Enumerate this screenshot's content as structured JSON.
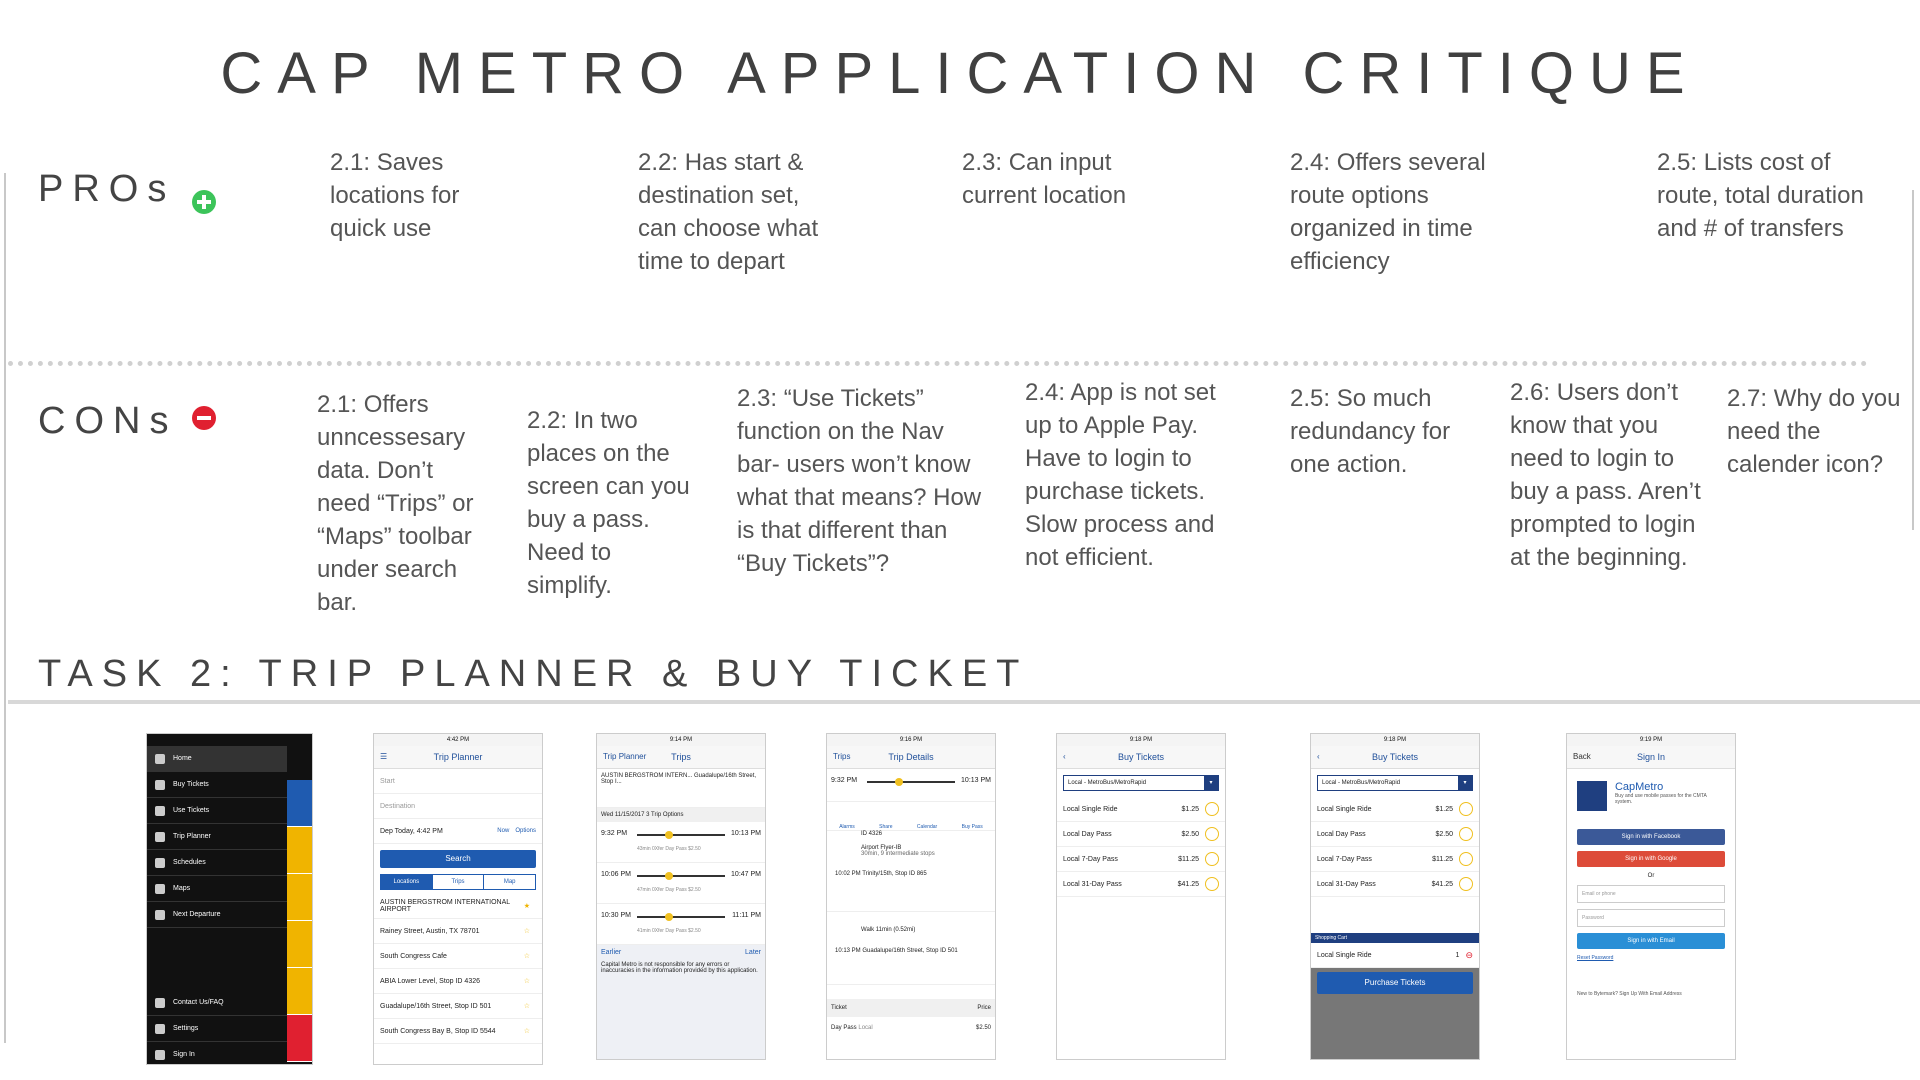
{
  "title": "CAP METRO APPLICATION CRITIQUE",
  "pros": {
    "label": "PROs",
    "items": [
      "2.1: Saves locations for quick use",
      "2.2: Has start & destination set, can choose what time to depart",
      "2.3: Can input current location",
      "2.4: Offers several route options organized in time efficiency",
      "2.5: Lists cost of route, total duration and # of transfers"
    ]
  },
  "cons": {
    "label": "CONs",
    "items": [
      "2.1: Offers unncessesary data. Don’t need “Trips” or “Maps” toolbar under search bar.",
      "2.2: In two places on the screen can you buy a pass. Need to simplify.",
      "2.3: “Use Tickets” function on the Nav bar- users won’t know what that means? How is that different than “Buy Tickets”?",
      "2.4: App is not set up to Apple Pay. Have to login to purchase tickets. Slow process and not efficient.",
      "2.5: So much redundancy for one action.",
      "2.6: Users don’t know that you need to login to buy a pass. Aren’t prompted to login at the beginning.",
      "2.7: Why do you need the calender icon?"
    ]
  },
  "task": "TASK 2: TRIP PLANNER & BUY TICKET",
  "screens": {
    "menu": {
      "items": [
        "Home",
        "Buy Tickets",
        "Use Tickets",
        "Trip Planner",
        "Schedules",
        "Maps",
        "Next Departure",
        "Contact Us/FAQ",
        "Settings",
        "Sign In"
      ],
      "strip_colors": [
        "#1f5bb0",
        "#f0b400",
        "#f0b400",
        "#f0b400",
        "#f0b400",
        "#e02030"
      ]
    },
    "planner": {
      "status": "4:42 PM",
      "title": "Trip Planner",
      "start": "Start",
      "destination": "Destination",
      "depart": "Dep Today, 4:42 PM",
      "now": "Now",
      "options": "Options",
      "search": "Search",
      "tabs": [
        "Locations",
        "Trips",
        "Map"
      ],
      "locations": [
        "AUSTIN BERGSTROM INTERNATIONAL AIRPORT",
        "Rainey Street, Austin, TX 78701",
        "South Congress Cafe",
        "ABIA Lower Level, Stop ID 4326",
        "Guadalupe/16th Street, Stop ID 501",
        "South Congress Bay B, Stop ID 5544"
      ]
    },
    "trips": {
      "status": "9:14 PM",
      "back": "Trip Planner",
      "title": "Trips",
      "route": "AUSTIN BERGSTROM INTERN... Guadalupe/16th Street, Stop I...",
      "date": "Wed 11/15/2017   3 Trip Options",
      "options": [
        {
          "dep": "9:32 PM",
          "arr": "10:13 PM",
          "meta": "43min  0Xfer  Day Pass $2.50"
        },
        {
          "dep": "10:06 PM",
          "arr": "10:47 PM",
          "meta": "47min  0Xfer  Day Pass $2.50"
        },
        {
          "dep": "10:30 PM",
          "arr": "11:11 PM",
          "meta": "41min  0Xfer  Day Pass $2.50"
        }
      ],
      "earlier": "Earlier",
      "later": "Later",
      "disclaimer": "Capital Metro is not responsible for any errors or inaccuracies in the information provided by this application."
    },
    "details": {
      "status": "9:16 PM",
      "back": "Trips",
      "title": "Trip Details",
      "dep": "9:32 PM",
      "arr": "10:13 PM",
      "actions": [
        "Alarms",
        "Share",
        "Calendar",
        "Buy Pass"
      ],
      "stop": "ID 4326",
      "route": "Airport Flyer-IB",
      "route_meta": "30min, 9 intermediate stops",
      "arrive_stop": "10:02 PM  Trinity/15th, Stop ID 865",
      "walk": "Walk 11min (0.52mi)",
      "final": "10:13 PM  Guadalupe/16th Street, Stop ID 501",
      "ticket_header": "Ticket",
      "price_header": "Price",
      "ticket": "Day Pass",
      "ticket_sub": "Local",
      "price": "$2.50"
    },
    "buy1": {
      "status": "9:18 PM",
      "title": "Buy Tickets",
      "select": "Local - MetroBus/MetroRapid",
      "items": [
        {
          "name": "Local Single Ride",
          "price": "$1.25"
        },
        {
          "name": "Local Day Pass",
          "price": "$2.50"
        },
        {
          "name": "Local 7-Day Pass",
          "price": "$11.25"
        },
        {
          "name": "Local 31-Day Pass",
          "price": "$41.25"
        }
      ]
    },
    "buy2": {
      "status": "9:18 PM",
      "title": "Buy Tickets",
      "select": "Local - MetroBus/MetroRapid",
      "items": [
        {
          "name": "Local Single Ride",
          "price": "$1.25"
        },
        {
          "name": "Local Day Pass",
          "price": "$2.50"
        },
        {
          "name": "Local 7-Day Pass",
          "price": "$11.25"
        },
        {
          "name": "Local 31-Day Pass",
          "price": "$41.25"
        }
      ],
      "cart_label": "Shopping Cart",
      "cart_item": "Local Single Ride",
      "cart_qty": "1",
      "purchase": "Purchase Tickets"
    },
    "signin": {
      "status": "9:19 PM",
      "back": "Back",
      "title": "Sign In",
      "brand": "CapMetro",
      "brand_desc": "Buy and use mobile passes for the CMTA system.",
      "facebook": "Sign in with Facebook",
      "google": "Sign in with Google",
      "or": "Or",
      "email_ph": "Email or phone",
      "password_ph": "Password",
      "email_btn": "Sign in with Email",
      "reset": "Reset Password",
      "new": "New to Bytemark? Sign Up With Email Address"
    }
  }
}
